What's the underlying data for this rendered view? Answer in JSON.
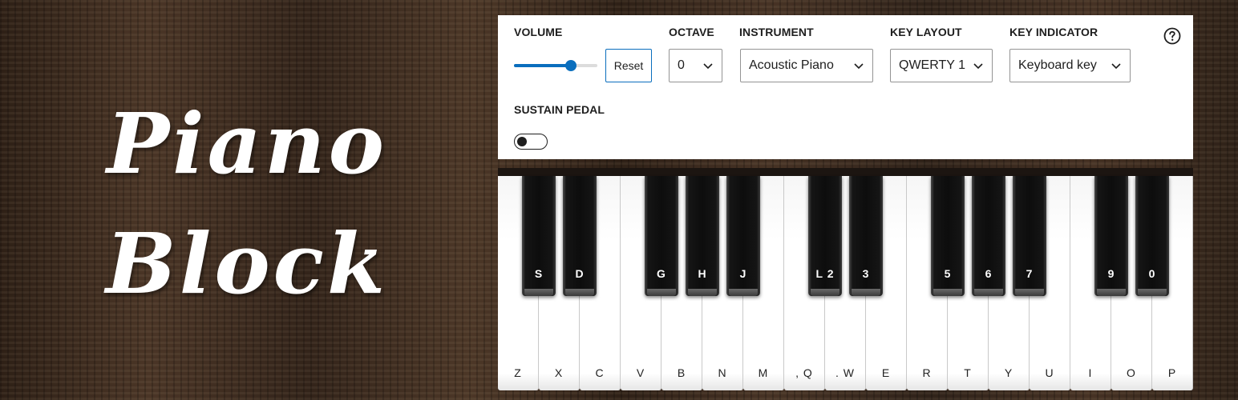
{
  "banner": {
    "title_line1": "Piano",
    "title_line2": "Block"
  },
  "controls": {
    "volume": {
      "label": "VOLUME",
      "level": 0.68,
      "reset_label": "Reset"
    },
    "octave": {
      "label": "OCTAVE",
      "value": "0"
    },
    "instrument": {
      "label": "INSTRUMENT",
      "value": "Acoustic Piano"
    },
    "key_layout": {
      "label": "KEY LAYOUT",
      "value": "QWERTY 1"
    },
    "key_indicator": {
      "label": "KEY INDICATOR",
      "value": "Keyboard key"
    },
    "sustain_pedal": {
      "label": "SUSTAIN PEDAL",
      "on": false
    },
    "help_icon": "question-circle-icon"
  },
  "keyboard": {
    "white_keys": [
      "Z",
      "X",
      "C",
      "V",
      "B",
      "N",
      "M",
      ", Q",
      ". W",
      "E",
      "R",
      "T",
      "Y",
      "U",
      "I",
      "O",
      "P"
    ],
    "black_keys": [
      "S",
      "D",
      "G",
      "H",
      "J",
      "L 2",
      "3",
      "5",
      "6",
      "7",
      "9",
      "0"
    ]
  },
  "colors": {
    "accent": "#0a6ebd",
    "panel_bg": "#ffffff",
    "black_key": "#111111",
    "white_key": "#ffffff"
  }
}
